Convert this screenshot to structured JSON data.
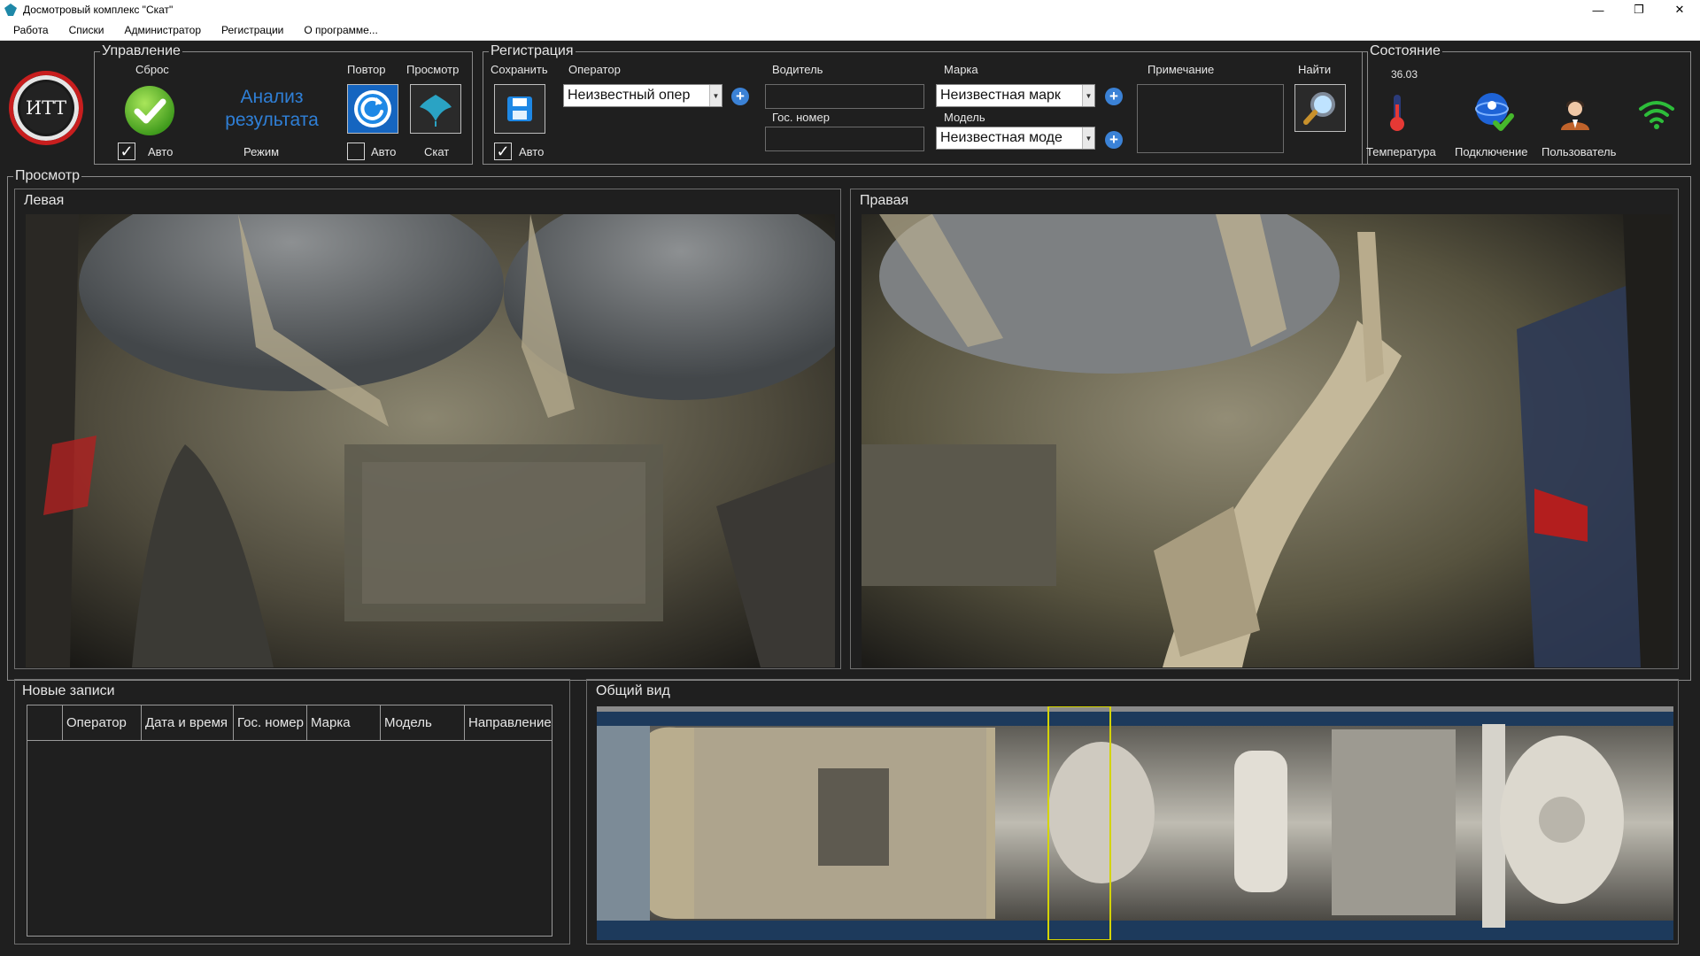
{
  "window": {
    "title": "Досмотровый комплекс \"Скат\"",
    "controls": {
      "minimize": "—",
      "restore": "❐",
      "close": "✕"
    }
  },
  "menu": [
    "Работа",
    "Списки",
    "Администратор",
    "Регистрации",
    "О программе..."
  ],
  "logo": {
    "text": "ИТТ"
  },
  "control": {
    "title": "Управление",
    "reset_label": "Сброс",
    "auto_label": "Авто",
    "analysis_text_line1": "Анализ",
    "analysis_text_line2": "результата",
    "mode_label": "Режим",
    "repeat_label": "Повтор",
    "view_label": "Просмотр",
    "repeat_auto_label": "Авто",
    "skat_label": "Скат"
  },
  "registration": {
    "title": "Регистрация",
    "save_label": "Сохранить",
    "operator_label": "Оператор",
    "operator_value": "Неизвестный опер",
    "auto_label": "Авто",
    "driver_label": "Водитель",
    "plate_label": "Гос. номер",
    "brand_label": "Марка",
    "brand_value": "Неизвестная марк",
    "model_label": "Модель",
    "model_value": "Неизвестная моде",
    "note_label": "Примечание",
    "find_label": "Найти"
  },
  "status": {
    "title": "Состояние",
    "temperature_value": "36.03",
    "temperature_label": "Температура",
    "connection_label": "Подключение",
    "user_label": "Пользователь"
  },
  "view": {
    "title": "Просмотр",
    "left_label": "Левая",
    "right_label": "Правая"
  },
  "records": {
    "title": "Новые записи",
    "columns": [
      "",
      "Оператор",
      "Дата и время",
      "Гос. номер",
      "Марка",
      "Модель",
      "Направление"
    ]
  },
  "overview": {
    "title": "Общий вид"
  },
  "colors": {
    "accent_blue": "#3b82d6",
    "analysis_text": "#2f7fd6",
    "marker_yellow": "#d4d400"
  }
}
